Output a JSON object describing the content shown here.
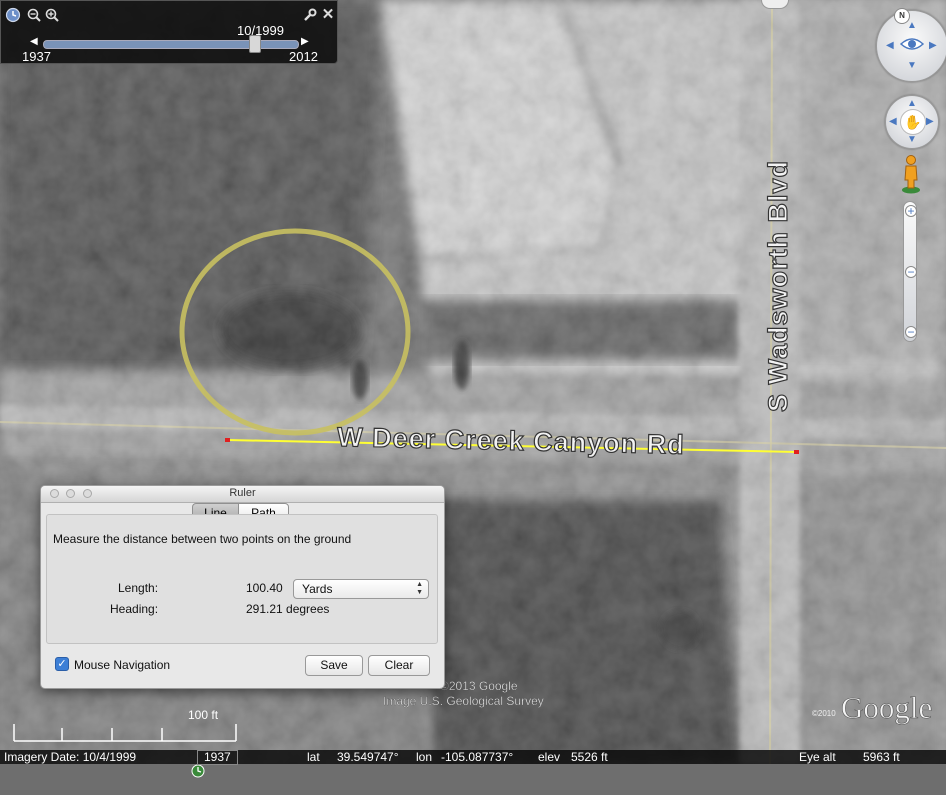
{
  "map": {
    "road_label_horizontal": "W Deer Creek Canyon Rd",
    "road_label_vertical": "S Wadsworth Blvd",
    "scale_label": "100 ft",
    "copyright_line1": "©2013 Google",
    "copyright_line2": "Image U.S. Geological Survey",
    "copyright_small": "©2010",
    "logo": "Google"
  },
  "timebar": {
    "current_date": "10/1999",
    "start_year": "1937",
    "end_year": "2012",
    "icons": [
      "clock-icon",
      "zoom-out-icon",
      "zoom-in-icon",
      "wrench-icon",
      "close-icon"
    ],
    "position_fraction": 0.83
  },
  "ruler": {
    "title": "Ruler",
    "tabs": [
      {
        "label": "Line",
        "selected": true
      },
      {
        "label": "Path",
        "selected": false
      }
    ],
    "description": "Measure the distance between two points on the ground",
    "length_label": "Length:",
    "length_value": "100.40",
    "unit": "Yards",
    "heading_label": "Heading:",
    "heading_value": "291.21 degrees",
    "mouse_navigation_label": "Mouse Navigation",
    "mouse_navigation_checked": true,
    "save_label": "Save",
    "clear_label": "Clear"
  },
  "statusbar": {
    "imagery_date": "Imagery Date: 10/4/1999",
    "year_value": "1937",
    "lat_label": "lat",
    "lat_value": "39.549747°",
    "lon_label": "lon",
    "lon_value": "-105.087737°",
    "elev_label": "elev",
    "elev_value": "5526 ft",
    "eye_alt_label": "Eye alt",
    "eye_alt_value": "5963 ft"
  },
  "nav": {
    "compass_north": "N",
    "zoom_in": "+",
    "zoom_out": "−"
  },
  "colors": {
    "ruler_line": "#ffff33",
    "ruler_endpoint": "#e02020",
    "highlight_circle": "#c8c060",
    "accent_blue": "#4a78c0"
  }
}
